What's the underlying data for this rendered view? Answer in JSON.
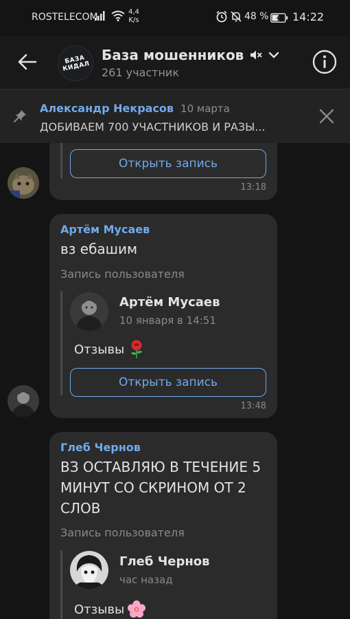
{
  "status": {
    "carrier": "ROSTELECOM",
    "speed": "4,4",
    "speed_unit": "K/s",
    "battery": "48 %",
    "time": "14:22"
  },
  "header": {
    "title": "База мошенников",
    "subtitle": "261 участник",
    "avatar_text": "БАЗА КИДАЛ"
  },
  "pinned": {
    "author": "Александр Некрасов",
    "date": "10 марта",
    "text": "ДОБИВАЕМ 700 УЧАСТНИКОВ И РАЗЫ..."
  },
  "messages": [
    {
      "open_label": "Открыть запись",
      "time": "13:18"
    },
    {
      "author": "Артём Мусаев",
      "text": "вз ебашим",
      "repost_label": "Запись пользователя",
      "repost_author": "Артём Мусаев",
      "repost_date": "10 января в 14:51",
      "repost_text": "Отзывы",
      "repost_emoji": "rose",
      "open_label": "Открыть запись",
      "time": "13:48"
    },
    {
      "author": "Глеб Чернов",
      "text": "ВЗ ОСТАВЛЯЮ В ТЕЧЕНИЕ 5 МИНУТ СО СКРИНОМ ОТ 2 СЛОВ",
      "repost_label": "Запись пользователя",
      "repost_author": "Глеб Чернов",
      "repost_date": "час назад",
      "repost_text": "Отзывы",
      "repost_emoji": "cherry-blossom"
    }
  ],
  "colors": {
    "background": "#141414",
    "bubble": "#2b2b2b",
    "accent": "#71aaeb"
  },
  "icons": [
    "back-arrow-icon",
    "muted-icon",
    "chevron-down-icon",
    "info-icon",
    "pin-icon",
    "close-icon",
    "rose-icon",
    "cherry-blossom-icon"
  ]
}
